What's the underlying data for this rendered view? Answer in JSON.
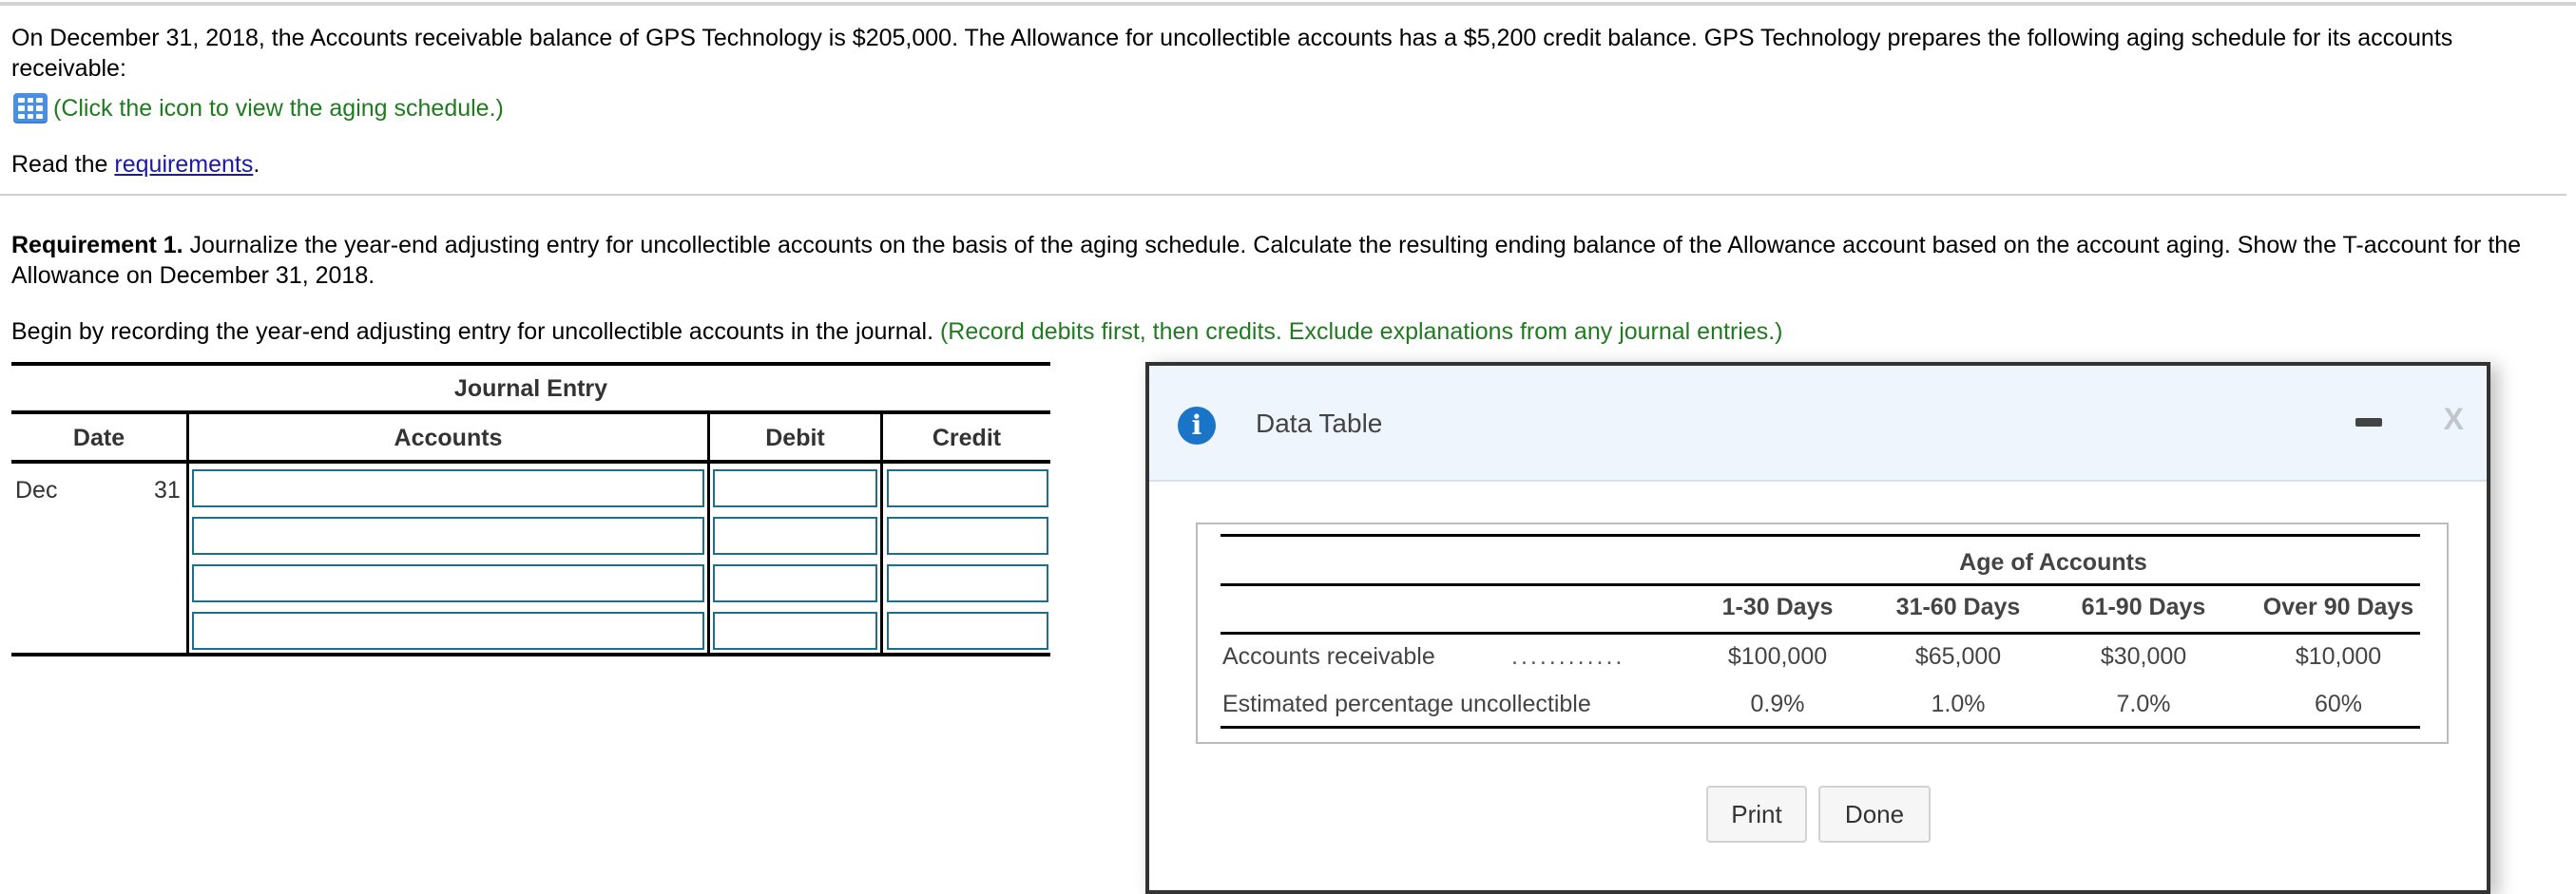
{
  "intro": {
    "text": "On December 31, 2018, the Accounts receivable balance of GPS Technology is $205,000. The Allowance for uncollectible accounts has a $5,200 credit balance. GPS Technology prepares the following aging schedule for its accounts receivable:",
    "icon": "table-grid-icon",
    "icon_link_text": "(Click the icon to view the aging schedule.)",
    "read_prefix": "Read the ",
    "read_link": "requirements",
    "read_suffix": "."
  },
  "requirement": {
    "label": "Requirement 1.",
    "text": " Journalize the year-end adjusting entry for uncollectible accounts on the basis of the aging schedule. Calculate the resulting ending balance of the Allowance account based on the account aging. Show the T-account for the Allowance on December 31, 2018.",
    "begin_text": "Begin by recording the year-end adjusting entry for uncollectible accounts in the journal. ",
    "begin_hint": "(Record debits first, then credits. Exclude explanations from any journal entries.)"
  },
  "journal": {
    "title": "Journal Entry",
    "columns": [
      "Date",
      "Accounts",
      "Debit",
      "Credit"
    ],
    "date_month": "Dec",
    "date_day": "31",
    "rows": [
      {
        "account": "",
        "debit": "",
        "credit": ""
      },
      {
        "account": "",
        "debit": "",
        "credit": ""
      },
      {
        "account": "",
        "debit": "",
        "credit": ""
      },
      {
        "account": "",
        "debit": "",
        "credit": ""
      }
    ]
  },
  "modal": {
    "title": "Data Table",
    "icon": "info-icon",
    "minimize_icon": "minimize-icon",
    "close_label": "X",
    "table": {
      "caption": "Age of Accounts",
      "columns": [
        "1-30 Days",
        "31-60 Days",
        "61-90 Days",
        "Over 90 Days"
      ],
      "rows": [
        {
          "label": "Accounts receivable",
          "leader": "............",
          "values": [
            "$100,000",
            "$65,000",
            "$30,000",
            "$10,000"
          ]
        },
        {
          "label": "Estimated percentage uncollectible",
          "leader": "",
          "values": [
            "0.9%",
            "1.0%",
            "7.0%",
            "60%"
          ]
        }
      ]
    },
    "buttons": {
      "print": "Print",
      "done": "Done"
    }
  },
  "colors": {
    "hint_green": "#207b20",
    "link_blue": "#1a1aa6",
    "input_border": "#1e6f8a",
    "info_blue": "#1a75c8",
    "modal_header_bg": "#eff5fc"
  }
}
